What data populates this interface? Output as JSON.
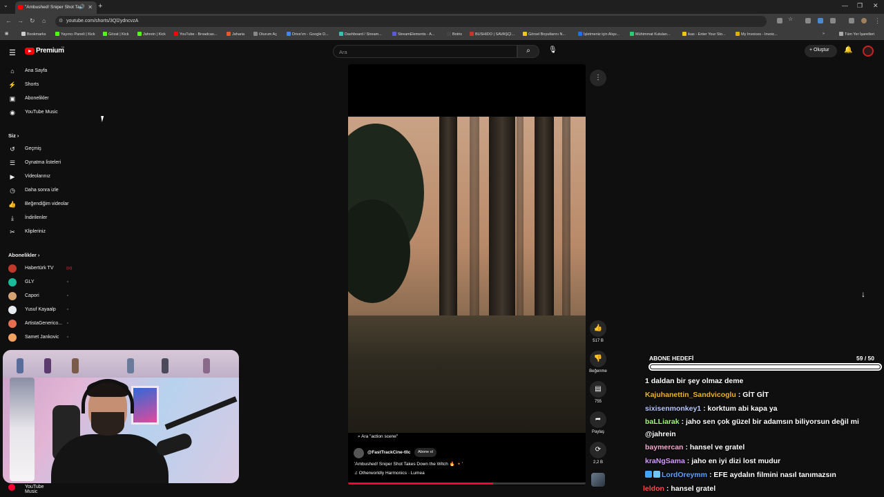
{
  "browser": {
    "tab_title": "\"Ambushed! Sniper Shot Ta",
    "url": "youtube.com/shorts/3Ql2ydncvzA",
    "bookmarks": [
      {
        "label": "Bookmarks",
        "color": "#cccccc"
      },
      {
        "label": "Yayıncı Paneli | Kick",
        "color": "#53fc18"
      },
      {
        "label": "Gözat | Kick",
        "color": "#53fc18"
      },
      {
        "label": "Jahrein | Kick",
        "color": "#53fc18"
      },
      {
        "label": "YouTube - Broadcas...",
        "color": "#ff0000"
      },
      {
        "label": "Jaharia",
        "color": "#e05a2b"
      },
      {
        "label": "Oturum Aç",
        "color": "#888888"
      },
      {
        "label": "Drive'ım - Google D...",
        "color": "#4285f4"
      },
      {
        "label": "Dashboard / Stream...",
        "color": "#2ec4b6"
      },
      {
        "label": "StreamElements - A...",
        "color": "#5b5bd6"
      },
      {
        "label": "Botrix",
        "color": "#444444"
      },
      {
        "label": "BUSHIDO | SAVAŞÇI...",
        "color": "#c0392b"
      },
      {
        "label": "Görsel Boyutlarını N...",
        "color": "#f5c518"
      },
      {
        "label": "İşletmeniz için Alışv...",
        "color": "#1a73e8"
      },
      {
        "label": "Mühimmat Kutuları...",
        "color": "#2ecc71"
      },
      {
        "label": "ikas - Enter Your Sto...",
        "color": "#f1c40f"
      },
      {
        "label": "My Invoices - Invoic...",
        "color": "#e0b000"
      }
    ],
    "all_bookmarks": "Tüm Yer İşaretleri"
  },
  "header": {
    "logo_text": "Premium",
    "logo_tr": "TR",
    "search_placeholder": "Ara",
    "create_label": "+ Oluştur"
  },
  "sidebar": {
    "main": [
      {
        "label": "Ana Sayfa",
        "icon": "home-icon",
        "glyph": "⌂"
      },
      {
        "label": "Shorts",
        "icon": "shorts-icon",
        "glyph": "⚡"
      },
      {
        "label": "Abonelikler",
        "icon": "subscriptions-icon",
        "glyph": "▣"
      },
      {
        "label": "YouTube Music",
        "icon": "music-icon",
        "glyph": "◉"
      }
    ],
    "you_heading": "Siz",
    "you": [
      {
        "label": "Geçmiş",
        "icon": "history-icon",
        "glyph": "↺"
      },
      {
        "label": "Oynatma listeleri",
        "icon": "playlists-icon",
        "glyph": "☰"
      },
      {
        "label": "Videolarınız",
        "icon": "your-videos-icon",
        "glyph": "▶"
      },
      {
        "label": "Daha sonra izle",
        "icon": "watch-later-icon",
        "glyph": "◷"
      },
      {
        "label": "Beğendiğim videolar",
        "icon": "liked-icon",
        "glyph": "👍"
      },
      {
        "label": "İndirilenler",
        "icon": "download-icon",
        "glyph": "⤓"
      },
      {
        "label": "Klipleriniz",
        "icon": "clips-icon",
        "glyph": "✂"
      }
    ],
    "subs_heading": "Abonelikler",
    "subs": [
      {
        "label": "Habertürk TV",
        "color": "#c0392b",
        "live": true
      },
      {
        "label": "GLY",
        "color": "#1abc9c",
        "live": false
      },
      {
        "label": "Capori",
        "color": "#d4a373",
        "live": false
      },
      {
        "label": "Yusuf Kayaalp",
        "color": "#e9ecef",
        "live": false
      },
      {
        "label": "ArtistaGenerico...",
        "color": "#e76f51",
        "live": false
      },
      {
        "label": "Samet Jankovic",
        "color": "#f4a261",
        "live": false
      }
    ],
    "music_bottom": "YouTube Music"
  },
  "video": {
    "scene_tag": "Ara \"action scene\"",
    "channel": "@FastTrackCine-tllc",
    "subscribe": "Abone ol",
    "title": "'Ambushed! Sniper Shot Takes Down the Witch 🔥 🔸'",
    "music": "♫ Otherworldly Harmonics · Lumea",
    "progress": 0.61,
    "actions": [
      {
        "name": "like",
        "label": "517 B",
        "glyph": "👍"
      },
      {
        "name": "dislike",
        "label": "Beğenme",
        "glyph": "👎"
      },
      {
        "name": "comments",
        "label": "755",
        "glyph": "▤"
      },
      {
        "name": "share",
        "label": "Paylaş",
        "glyph": "➦"
      },
      {
        "name": "remix",
        "label": "2,2 B",
        "glyph": "⟳"
      }
    ]
  },
  "overlay": {
    "goal_title": "ABONE HEDEFİ",
    "goal_count": "59 / 50",
    "goal_progress": 1.0,
    "chat": [
      {
        "user": "",
        "color": "#ffffff",
        "message": "1 daldan bir şey olmaz deme"
      },
      {
        "user": "Kajuhanettin_Sandvicoglu",
        "color": "#f0b429",
        "message": ": GİT GİT"
      },
      {
        "user": "sixisenmonkey1",
        "color": "#b8c7ff",
        "message": ": korktum abi kapa ya"
      },
      {
        "user": "baLLiarak",
        "color": "#9bff6b",
        "message": ": jaho sen çok güzel bir adamsın biliyorsun değil mi"
      },
      {
        "user": "",
        "color": "#ffffff",
        "message": "@jahrein"
      },
      {
        "user": "baymercan",
        "color": "#f7a9d0",
        "message": ": hansel ve gratel"
      },
      {
        "user": "kraNgSama",
        "color": "#d59bff",
        "message": ": jaho en iyi dizi lost mudur"
      },
      {
        "user": "LordOreymm",
        "color": "#5ba3ff",
        "message": ": EFE aydalın filmini nasıl tanımazsın"
      },
      {
        "user": "leldon",
        "color": "#ff4d4d",
        "message": ": hansel gratel"
      }
    ]
  }
}
